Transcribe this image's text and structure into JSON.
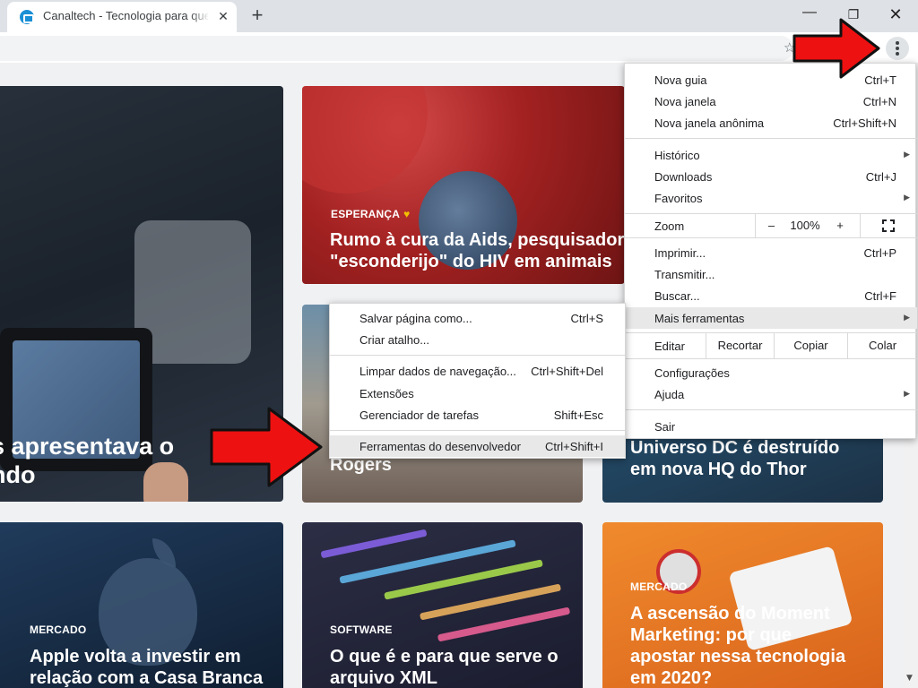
{
  "browser": {
    "tab_title": "Canaltech - Tecnologia para quem",
    "tab_close": "✕",
    "new_tab": "+",
    "window_minimize": "—",
    "window_restore": "❐",
    "window_close": "✕",
    "icons": [
      "favicon-icon",
      "star-icon",
      "menu-icon"
    ]
  },
  "page": {
    "hero": {
      "title_line1": "s apresentava o",
      "title_line2": "ndo"
    },
    "aids": {
      "label": "ESPERANÇA",
      "heart": "♥",
      "title_line1": "Rumo à cura da Aids, pesquisadores",
      "title_line2": "\"esconderijo\" do HIV em animais"
    },
    "mid2": {
      "title": "Rogers"
    },
    "mid3": {
      "title_line1": "Universo DC é destruído",
      "title_line2": "em nova HQ do Thor"
    },
    "apple": {
      "label": "MERCADO",
      "title_line1": "Apple volta a investir em",
      "title_line2": "relação com a Casa Branca"
    },
    "code": {
      "label": "SOFTWARE",
      "title_line1": "O que é e para que serve o",
      "title_line2": "arquivo XML"
    },
    "moment": {
      "label": "MERCADO",
      "title_line1": "A ascensão do Moment",
      "title_line2": "Marketing: por que",
      "title_line3": "apostar nessa tecnologia",
      "title_line4": "em 2020?"
    }
  },
  "main_menu": {
    "new_tab": {
      "label": "Nova guia",
      "shortcut": "Ctrl+T"
    },
    "new_window": {
      "label": "Nova janela",
      "shortcut": "Ctrl+N"
    },
    "incognito": {
      "label": "Nova janela anônima",
      "shortcut": "Ctrl+Shift+N"
    },
    "history": {
      "label": "Histórico"
    },
    "downloads": {
      "label": "Downloads",
      "shortcut": "Ctrl+J"
    },
    "bookmarks": {
      "label": "Favoritos"
    },
    "zoom": {
      "label": "Zoom",
      "minus": "–",
      "value": "100%",
      "plus": "+"
    },
    "print": {
      "label": "Imprimir...",
      "shortcut": "Ctrl+P"
    },
    "cast": {
      "label": "Transmitir..."
    },
    "find": {
      "label": "Buscar...",
      "shortcut": "Ctrl+F"
    },
    "more_tools": {
      "label": "Mais ferramentas"
    },
    "edit": {
      "label": "Editar",
      "cut": "Recortar",
      "copy": "Copiar",
      "paste": "Colar"
    },
    "settings": {
      "label": "Configurações"
    },
    "help": {
      "label": "Ajuda"
    },
    "exit": {
      "label": "Sair"
    },
    "submenu_arrow": "▶"
  },
  "sub_menu": {
    "save_page": {
      "label": "Salvar página como...",
      "shortcut": "Ctrl+S"
    },
    "create_shortcut": {
      "label": "Criar atalho..."
    },
    "clear_data": {
      "label": "Limpar dados de navegação...",
      "shortcut": "Ctrl+Shift+Del"
    },
    "extensions": {
      "label": "Extensões"
    },
    "task_manager": {
      "label": "Gerenciador de tarefas",
      "shortcut": "Shift+Esc"
    },
    "dev_tools": {
      "label": "Ferramentas do desenvolvedor",
      "shortcut": "Ctrl+Shift+I"
    }
  },
  "colors": {
    "accent_arrow": "#ee1111",
    "menu_highlight": "#e8e8e8",
    "heart": "#f2c200"
  }
}
